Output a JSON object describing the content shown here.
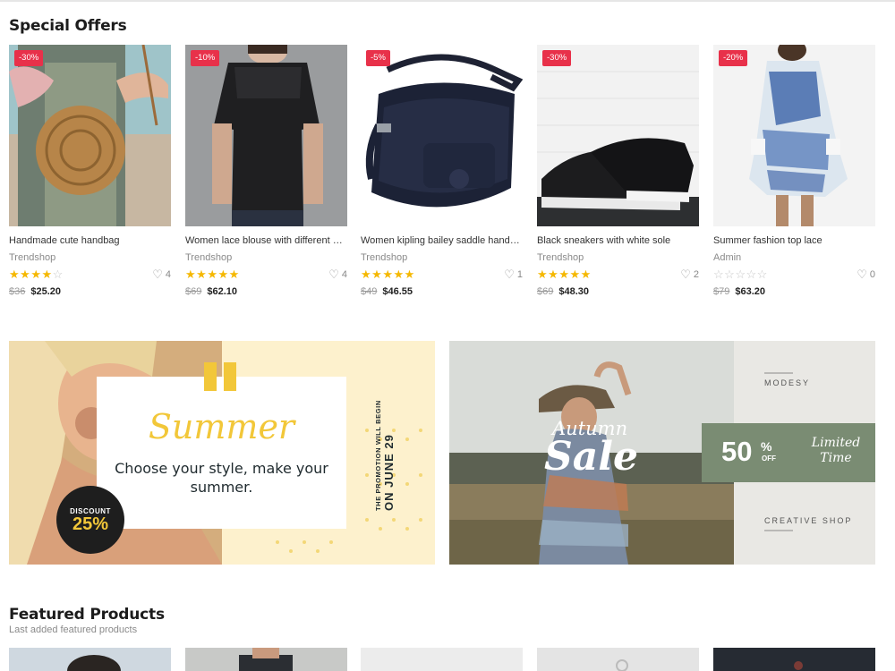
{
  "special_offers": {
    "title": "Special Offers",
    "products": [
      {
        "badge": "-30%",
        "name": "Handmade cute handbag",
        "vendor": "Trendshop",
        "rating": 4,
        "likes": "4",
        "old_price": "$36",
        "price": "$25.20"
      },
      {
        "badge": "-10%",
        "name": "Women lace blouse with different colors",
        "vendor": "Trendshop",
        "rating": 5,
        "likes": "4",
        "old_price": "$69",
        "price": "$62.10"
      },
      {
        "badge": "-5%",
        "name": "Women kipling bailey saddle handbag",
        "vendor": "Trendshop",
        "rating": 5,
        "likes": "1",
        "old_price": "$49",
        "price": "$46.55"
      },
      {
        "badge": "-30%",
        "name": "Black sneakers with white sole",
        "vendor": "Trendshop",
        "rating": 5,
        "likes": "2",
        "old_price": "$69",
        "price": "$48.30"
      },
      {
        "badge": "-20%",
        "name": "Summer fashion top lace",
        "vendor": "Admin",
        "rating": 0,
        "likes": "0",
        "old_price": "$79",
        "price": "$63.20"
      }
    ]
  },
  "banner_left": {
    "script_word": "Summer",
    "headline": "Choose your style, make your summer.",
    "discount_label": "DISCOUNT",
    "discount_value": "25%",
    "promo_line1": "THE PROMOTION WILL BEGIN",
    "promo_line2": "ON JUNE 29"
  },
  "banner_right": {
    "brand_top": "MODESY",
    "script_line1": "Autumn",
    "script_line2": "Sale",
    "percent": "50",
    "percent_sign": "%",
    "off": "OFF",
    "limited": "Limited Time",
    "brand_bottom": "CREATIVE SHOP"
  },
  "featured": {
    "title": "Featured Products",
    "subtitle": "Last added featured products"
  },
  "colors": {
    "badge": "#e8314a",
    "star": "#f5b800",
    "accent_yellow": "#f2c739",
    "accent_green": "#7a8c73"
  },
  "icons": [
    "heart-icon",
    "star-icon"
  ]
}
